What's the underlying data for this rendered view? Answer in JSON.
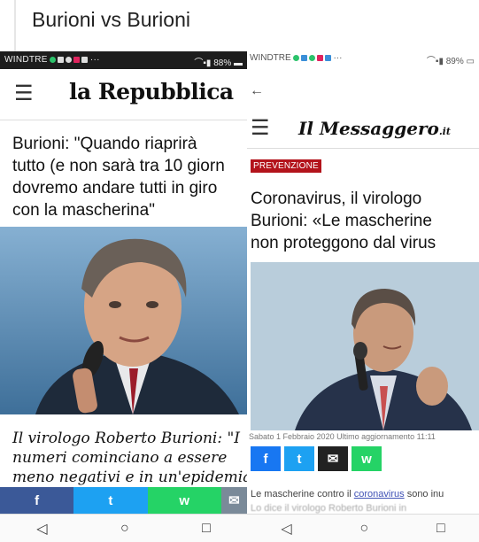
{
  "caption": "Burioni vs Burioni",
  "left": {
    "status_carrier": "WINDTRE",
    "status_right": "88%",
    "menu_icon": "☰",
    "brand": "la Repubblica",
    "headline": "Burioni: \"Quando riaprirà\ntutto (e non sarà tra 10 giorn\ndovremo andare tutti in giro\ncon la mascherina\"",
    "subheadline": "Il virologo Roberto Burioni: \"I\nnumeri cominciano a essere\nmeno negativi e in un'epidemia",
    "share": [
      "f",
      "t",
      "w",
      "✉"
    ],
    "share_colors": [
      "#3b5998",
      "#1da1f2",
      "#25d366",
      "#7a8a99"
    ],
    "nav": [
      "◁",
      "○",
      "□"
    ]
  },
  "right": {
    "status_carrier": "WINDTRE",
    "status_right": "89%",
    "back_icon": "←",
    "menu_icon": "☰",
    "brand": "Il Messaggero",
    "brand_suffix": ".it",
    "tag": "PREVENZIONE",
    "headline": "Coronavirus, il virologo\nBurioni: «Le mascherine\nnon proteggono dal virus",
    "date": "Sabato 1 Febbraio 2020 Ultimo aggiornamento 11:11",
    "share": [
      "f",
      "t",
      "✉",
      "w"
    ],
    "share_colors": [
      "#1877f2",
      "#1da1f2",
      "#222222",
      "#25d366"
    ],
    "lead_prefix": "Le mascherine contro il ",
    "lead_link": "coronavirus",
    "lead_suffix": " sono inu",
    "lead_blur": "Lo dice il virologo Roberto Burioni in",
    "nav": [
      "◁",
      "○",
      "□"
    ]
  }
}
